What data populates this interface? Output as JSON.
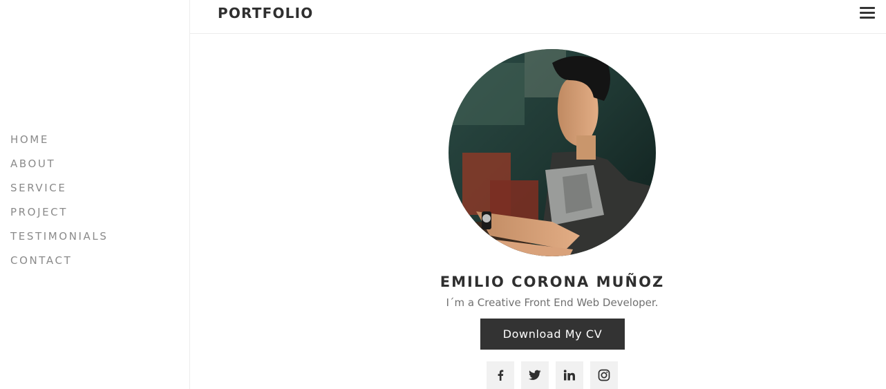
{
  "header": {
    "brand": "PORTFOLIO",
    "menu_icon": "hamburger-menu-icon"
  },
  "sidebar": {
    "items": [
      {
        "label": "HOME"
      },
      {
        "label": "ABOUT"
      },
      {
        "label": "SERVICE"
      },
      {
        "label": "PROJECT"
      },
      {
        "label": "TESTIMONIALS"
      },
      {
        "label": "CONTACT"
      }
    ]
  },
  "profile": {
    "photo": "profile-photo",
    "name": "EMILIO CORONA MUÑOZ",
    "tagline": "I´m a Creative Front End Web Developer.",
    "cv_button": "Download My CV"
  },
  "social": [
    {
      "icon": "facebook-icon"
    },
    {
      "icon": "twitter-icon"
    },
    {
      "icon": "linkedin-icon"
    },
    {
      "icon": "instagram-icon"
    }
  ],
  "colors": {
    "button_bg": "#333333",
    "nav_text": "#8a8a8a",
    "social_bg": "#f1f1f1"
  }
}
